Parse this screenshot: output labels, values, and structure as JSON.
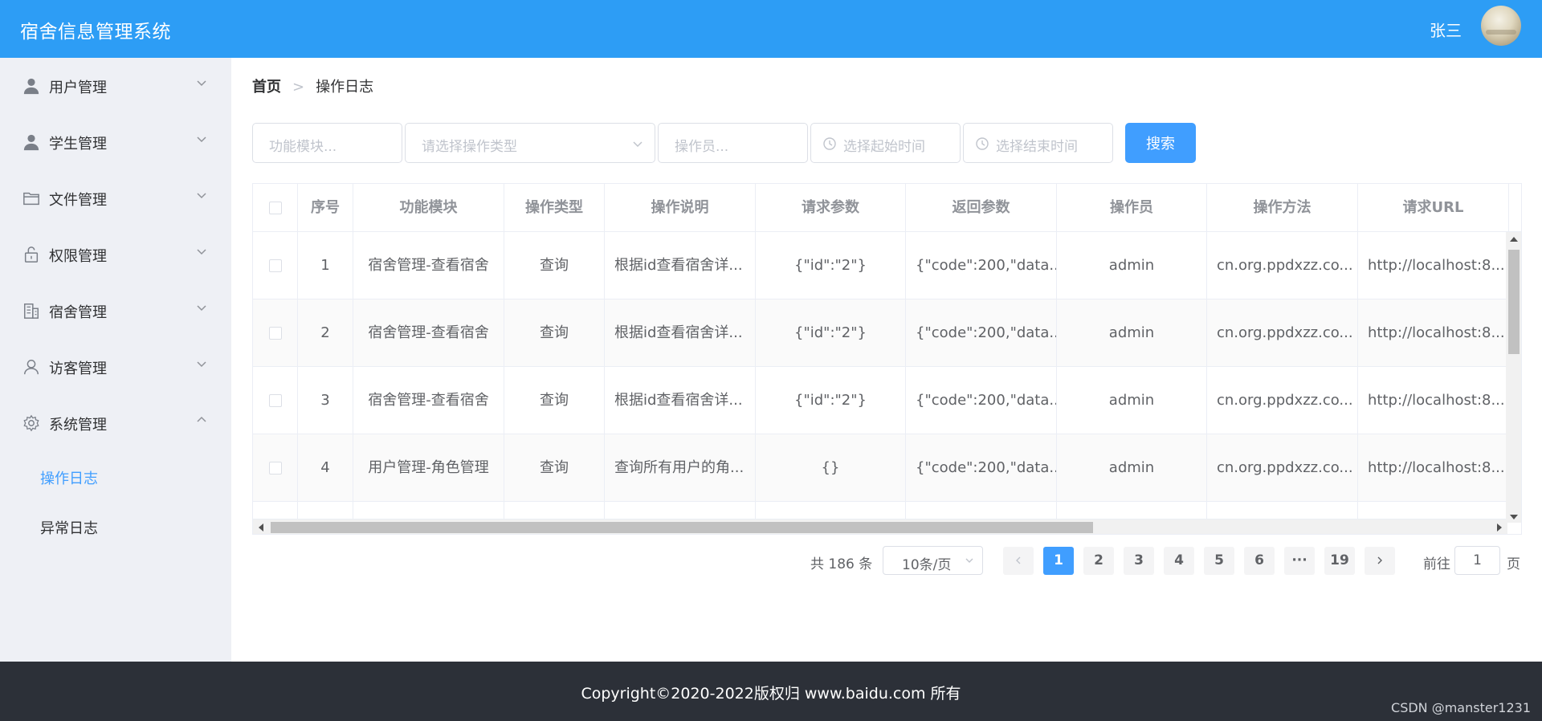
{
  "header": {
    "title": "宿舍信息管理系统",
    "user_name": "张三"
  },
  "sidebar": {
    "items": [
      {
        "label": "用户管理",
        "icon": "user-icon"
      },
      {
        "label": "学生管理",
        "icon": "user-icon"
      },
      {
        "label": "文件管理",
        "icon": "folder-icon"
      },
      {
        "label": "权限管理",
        "icon": "lock-icon"
      },
      {
        "label": "宿舍管理",
        "icon": "building-icon"
      },
      {
        "label": "访客管理",
        "icon": "visitor-icon"
      },
      {
        "label": "系统管理",
        "icon": "gear-icon"
      }
    ],
    "sub_items": [
      {
        "label": "操作日志",
        "active": true
      },
      {
        "label": "异常日志",
        "active": false
      }
    ]
  },
  "breadcrumb": {
    "home": "首页",
    "current": "操作日志"
  },
  "filters": {
    "module_placeholder": "功能模块...",
    "type_placeholder": "请选择操作类型",
    "operator_placeholder": "操作员...",
    "start_placeholder": "选择起始时间",
    "end_placeholder": "选择结束时间",
    "search_label": "搜索"
  },
  "table": {
    "columns": [
      "序号",
      "功能模块",
      "操作类型",
      "操作说明",
      "请求参数",
      "返回参数",
      "操作员",
      "操作方法",
      "请求URL"
    ],
    "rows": [
      [
        "1",
        "宿舍管理-查看宿舍",
        "查询",
        "根据id查看宿舍详...",
        "{\"id\":\"2\"}",
        "{\"code\":200,\"data...",
        "admin",
        "cn.org.ppdxzz.co...",
        "http://localhost:8..."
      ],
      [
        "2",
        "宿舍管理-查看宿舍",
        "查询",
        "根据id查看宿舍详...",
        "{\"id\":\"2\"}",
        "{\"code\":200,\"data...",
        "admin",
        "cn.org.ppdxzz.co...",
        "http://localhost:8..."
      ],
      [
        "3",
        "宿舍管理-查看宿舍",
        "查询",
        "根据id查看宿舍详...",
        "{\"id\":\"2\"}",
        "{\"code\":200,\"data...",
        "admin",
        "cn.org.ppdxzz.co...",
        "http://localhost:8..."
      ],
      [
        "4",
        "用户管理-角色管理",
        "查询",
        "查询所有用户的角...",
        "{}",
        "{\"code\":200,\"data...",
        "admin",
        "cn.org.ppdxzz.co...",
        "http://localhost:8..."
      ]
    ]
  },
  "pagination": {
    "total_text": "共 186 条",
    "page_size": "10条/页",
    "pages": [
      "1",
      "2",
      "3",
      "4",
      "5",
      "6",
      "···",
      "19"
    ],
    "current": "1",
    "jump_label": "前往",
    "jump_value": "1",
    "jump_unit": "页"
  },
  "footer": {
    "copyright": "Copyright©2020-2022版权归 www.baidu.com 所有",
    "watermark": "CSDN @manster1231"
  },
  "colors": {
    "header": "#2d9df5",
    "primary": "#409eff",
    "sidebar": "#eef0f5",
    "footer": "#2c3038"
  }
}
